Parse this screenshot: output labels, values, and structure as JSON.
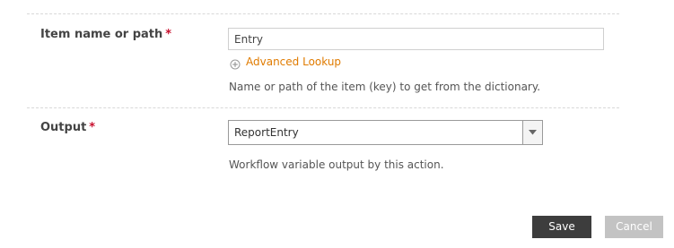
{
  "form": {
    "item_field": {
      "label": "Item name or path",
      "required_marker": "*",
      "value": "Entry",
      "advanced_lookup_label": "Advanced Lookup",
      "help": "Name or path of the item (key) to get from the dictionary."
    },
    "output_field": {
      "label": "Output",
      "required_marker": "*",
      "selected": "ReportEntry",
      "help": "Workflow variable output by this action."
    }
  },
  "footer": {
    "save_label": "Save",
    "cancel_label": "Cancel"
  },
  "icons": {
    "advanced_lookup": "plus-circle-icon",
    "dropdown": "triangle-down-icon"
  },
  "colors": {
    "required": "#c8102e",
    "link": "#e07b00",
    "save_button": "#3d3d3d",
    "cancel_button": "#c3c3c3"
  }
}
